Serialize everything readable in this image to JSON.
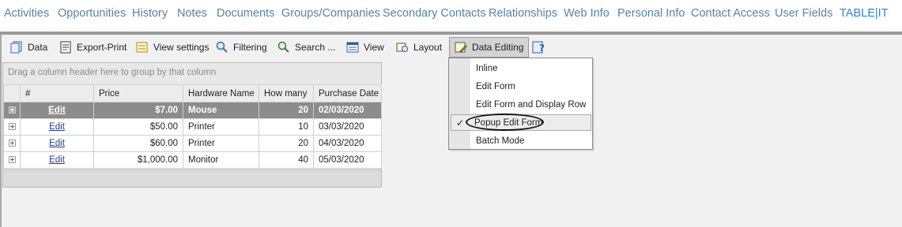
{
  "nav": {
    "tabs": [
      {
        "label": "Activities"
      },
      {
        "label": "Opportunities"
      },
      {
        "label": "History"
      },
      {
        "label": "Notes"
      },
      {
        "label": "Documents"
      },
      {
        "label": "Groups/Companies"
      },
      {
        "label": "Secondary Contacts"
      },
      {
        "label": "Relationships"
      },
      {
        "label": "Web Info"
      },
      {
        "label": "Personal Info"
      },
      {
        "label": "Contact Access"
      },
      {
        "label": "User Fields"
      },
      {
        "label": "TABLE|IT"
      }
    ]
  },
  "toolbar": {
    "items": [
      {
        "label": "Data",
        "icon": "data-icon"
      },
      {
        "label": "Export-Print",
        "icon": "export-print-icon"
      },
      {
        "label": "View settings",
        "icon": "view-settings-icon"
      },
      {
        "label": "Filtering",
        "icon": "filtering-icon"
      },
      {
        "label": "Search ...",
        "icon": "search-icon"
      },
      {
        "label": "View",
        "icon": "view-icon"
      },
      {
        "label": "Layout",
        "icon": "layout-icon"
      },
      {
        "label": "Data Editing",
        "icon": "data-editing-icon"
      }
    ],
    "help_icon": "help-icon"
  },
  "grid": {
    "group_hint": "Drag a column header here to group by that column",
    "columns": [
      "#",
      "Price",
      "Hardware Name",
      "How many",
      "Purchase Date"
    ],
    "rows": [
      {
        "link": "Edit",
        "price": "$7.00",
        "name": "Mouse",
        "qty": "20",
        "date": "02/03/2020"
      },
      {
        "link": "Edit",
        "price": "$50.00",
        "name": "Printer",
        "qty": "10",
        "date": "03/03/2020"
      },
      {
        "link": "Edit",
        "price": "$60.00",
        "name": "Printer",
        "qty": "20",
        "date": "04/03/2020"
      },
      {
        "link": "Edit",
        "price": "$1,000.00",
        "name": "Monitor",
        "qty": "40",
        "date": "05/03/2020"
      }
    ]
  },
  "menu": {
    "items": [
      {
        "label": "Inline"
      },
      {
        "label": "Edit Form"
      },
      {
        "label": "Edit Form and Display Row"
      },
      {
        "label": "Popup Edit Form",
        "checked": true
      },
      {
        "label": "Batch Mode"
      }
    ],
    "check_mark": "✓"
  },
  "colors": {
    "nav_text": "#5a82a6",
    "selected_row": "#8c8c8c",
    "link": "#1f3c94"
  }
}
